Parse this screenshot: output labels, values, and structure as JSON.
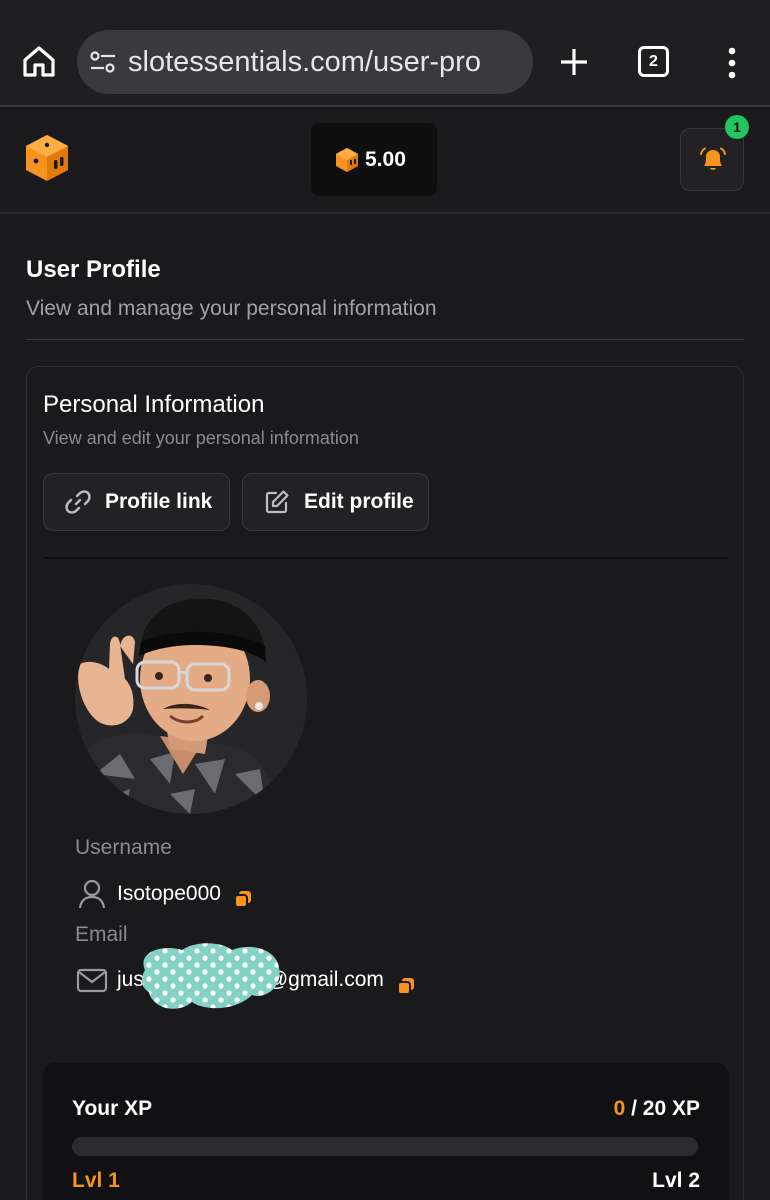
{
  "browser": {
    "url": "slotessentials.com/user-pro",
    "tab_count": "2",
    "icons": [
      "home-icon",
      "site-settings-icon",
      "new-tab-icon",
      "tab-switcher-icon",
      "more-menu-icon"
    ]
  },
  "header": {
    "balance": "5.00",
    "notification_count": "1",
    "accent_color": "#f7931e",
    "badge_color": "#22c55e"
  },
  "page": {
    "title": "User Profile",
    "subtitle": "View and manage your personal information"
  },
  "personal": {
    "title": "Personal Information",
    "subtitle": "View and edit your personal information",
    "profile_link_label": "Profile link",
    "edit_profile_label": "Edit profile",
    "username_label": "Username",
    "username": "Isotope000",
    "email_label": "Email",
    "email_prefix": "jus",
    "email_suffix": "@gmail.com"
  },
  "xp": {
    "title": "Your XP",
    "current": "0",
    "total": "/ 20 XP",
    "progress_fraction": 0,
    "level_current": "Lvl 1",
    "level_next": "Lvl 2"
  }
}
